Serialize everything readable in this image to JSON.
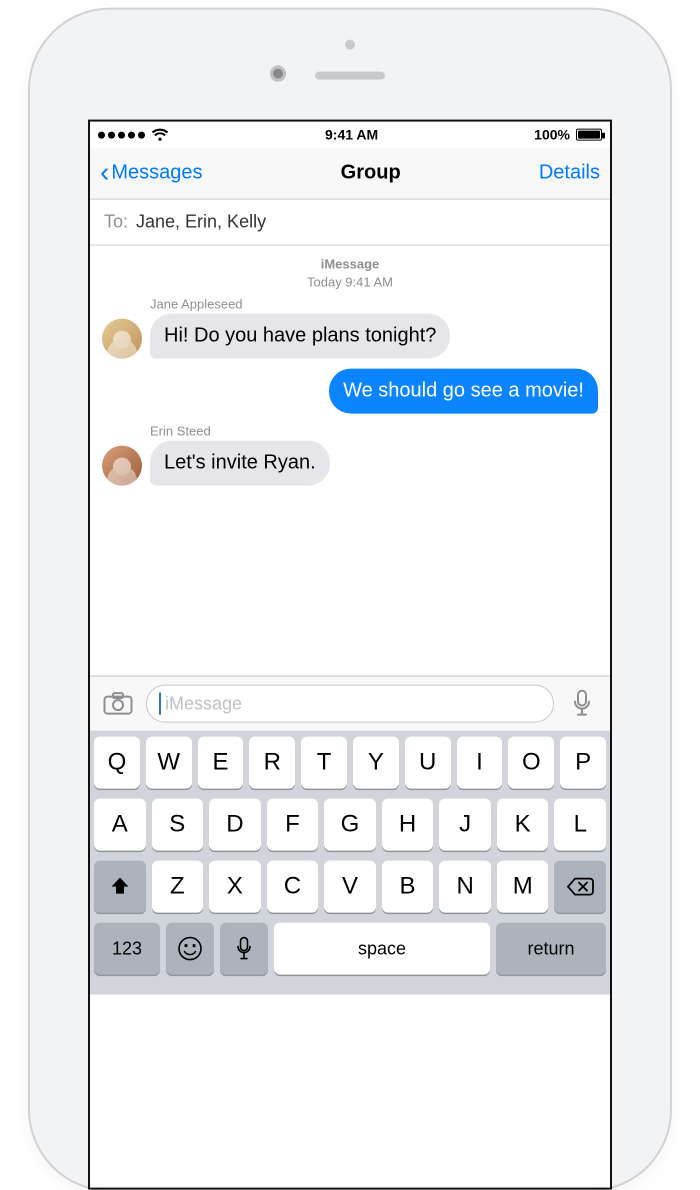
{
  "statusbar": {
    "time": "9:41 AM",
    "battery_pct": "100%"
  },
  "nav": {
    "back_label": "Messages",
    "title": "Group",
    "details_label": "Details"
  },
  "to_field": {
    "label": "To:",
    "recipients": "Jane, Erin, Kelly"
  },
  "thread": {
    "service": "iMessage",
    "timestamp": "Today 9:41 AM",
    "messages": [
      {
        "sender": "Jane Appleseed",
        "direction": "in",
        "text": "Hi! Do you have plans tonight?"
      },
      {
        "sender": null,
        "direction": "out",
        "text": "We should go see a movie!"
      },
      {
        "sender": "Erin Steed",
        "direction": "in",
        "text": "Let's invite Ryan."
      }
    ]
  },
  "compose": {
    "placeholder": "iMessage"
  },
  "keyboard": {
    "row1": [
      "Q",
      "W",
      "E",
      "R",
      "T",
      "Y",
      "U",
      "I",
      "O",
      "P"
    ],
    "row2": [
      "A",
      "S",
      "D",
      "F",
      "G",
      "H",
      "J",
      "K",
      "L"
    ],
    "row3": [
      "Z",
      "X",
      "C",
      "V",
      "B",
      "N",
      "M"
    ],
    "numbers_label": "123",
    "space_label": "space",
    "return_label": "return"
  }
}
